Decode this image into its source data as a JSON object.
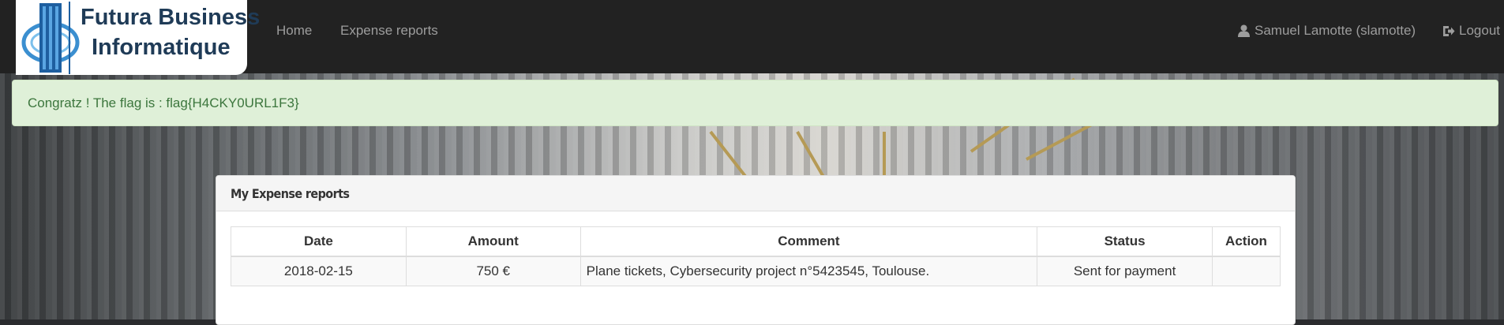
{
  "brand": {
    "line1": "Futura Business",
    "line2": "Informatique"
  },
  "nav": {
    "home": "Home",
    "expense_reports": "Expense reports",
    "user": "Samuel Lamotte (slamotte)",
    "logout": "Logout"
  },
  "alert": {
    "message": "Congratz ! The flag is : flag{H4CKY0URL1F3}"
  },
  "panel": {
    "title": "My Expense reports",
    "columns": [
      "Date",
      "Amount",
      "Comment",
      "Status",
      "Action"
    ],
    "rows": [
      {
        "date": "2018-02-15",
        "amount": "750 €",
        "comment": "Plane tickets, Cybersecurity project n°5423545, Toulouse.",
        "status": "Sent for payment",
        "action": ""
      }
    ]
  },
  "colors": {
    "navbar": "#222222",
    "nav_text": "#9d9d9d",
    "alert_bg": "#dff0d8",
    "alert_text": "#3c763d",
    "brand_text": "#1f3b57"
  },
  "icons": {
    "user": "user-icon",
    "logout": "logout-icon",
    "logo": "building-globe-logo-icon"
  }
}
